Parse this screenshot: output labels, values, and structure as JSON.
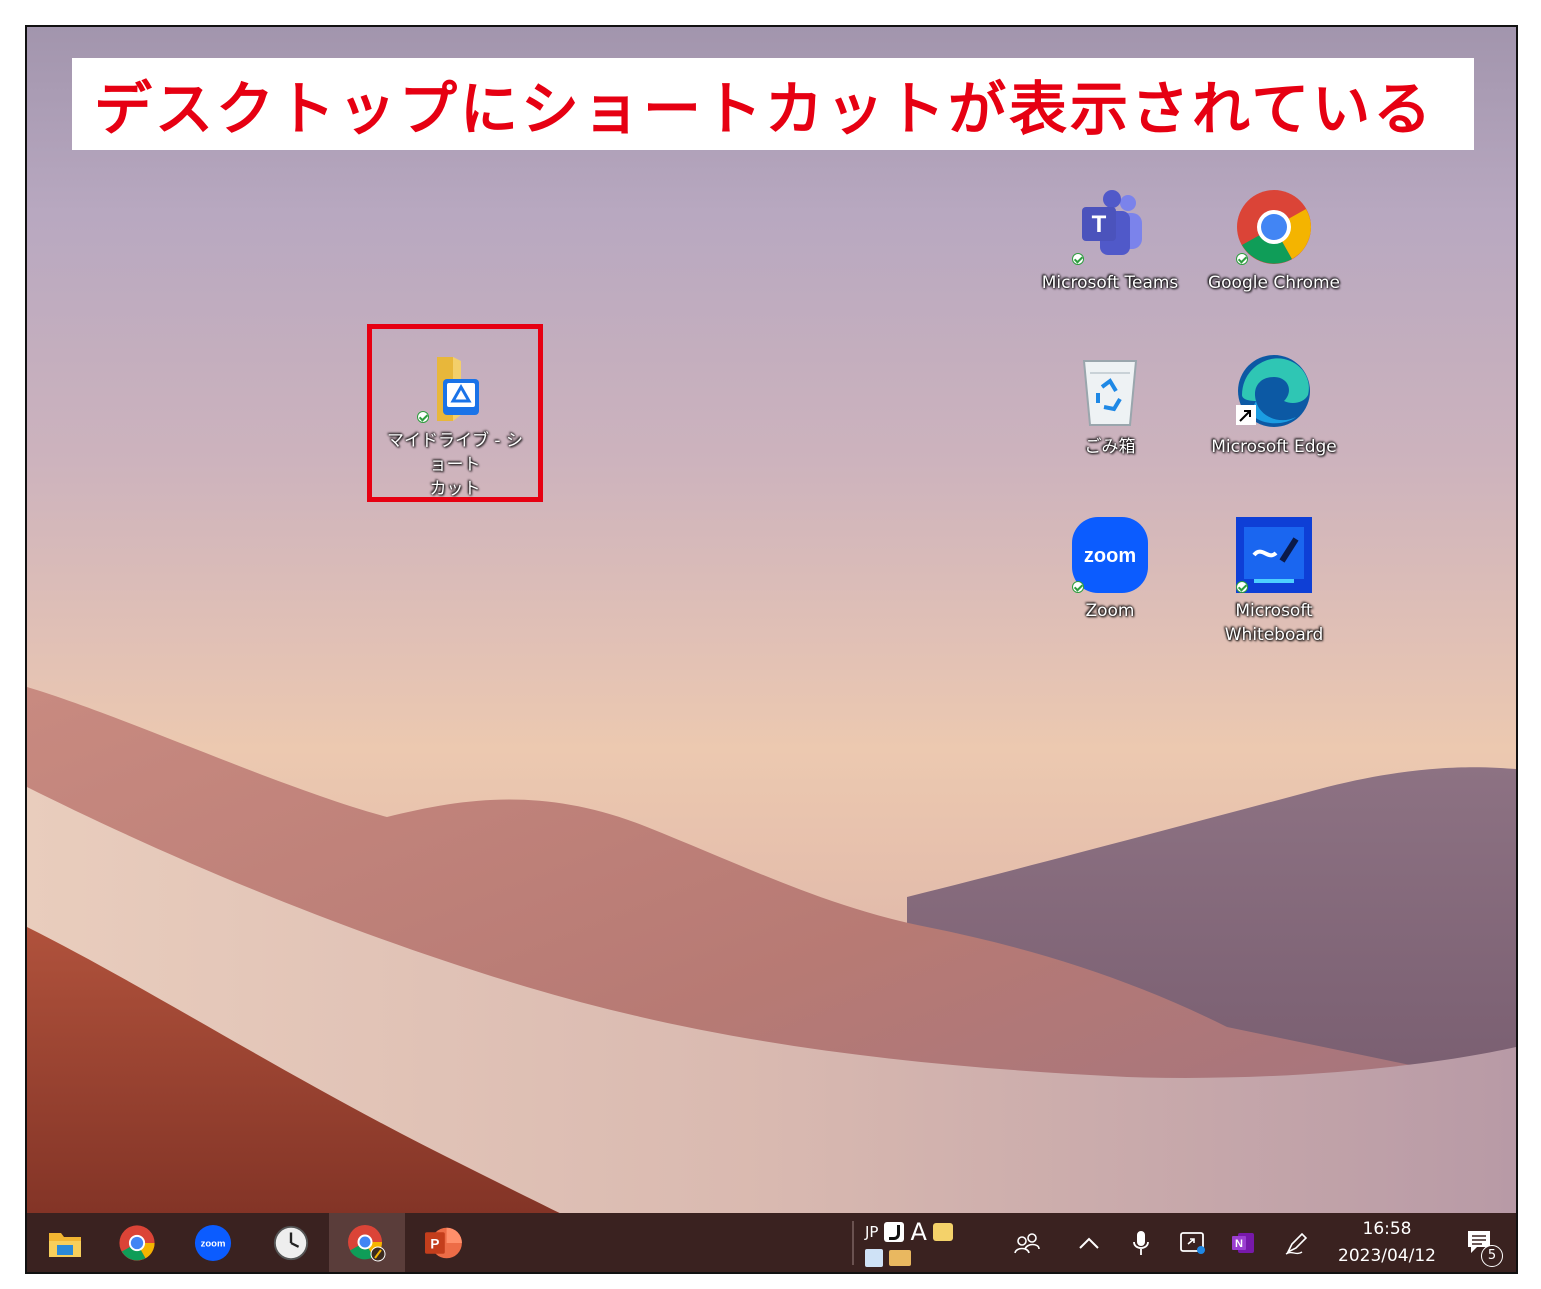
{
  "banner": {
    "text": "デスクトップにショートカットが表示されている"
  },
  "desktop_icons": {
    "drive_shortcut": {
      "label": "マイドライブ - ショート\nカット",
      "icon": "google-drive-folder-icon"
    },
    "teams": {
      "label": "Microsoft Teams",
      "icon": "teams-icon"
    },
    "chrome": {
      "label": "Google Chrome",
      "icon": "chrome-icon"
    },
    "recycle_bin": {
      "label": "ごみ箱",
      "icon": "recycle-bin-icon"
    },
    "edge": {
      "label": "Microsoft Edge",
      "icon": "edge-icon"
    },
    "zoom": {
      "label": "Zoom",
      "icon": "zoom-icon",
      "logo_text": "zoom"
    },
    "whiteboard": {
      "label": "Microsoft\nWhiteboard",
      "icon": "whiteboard-icon"
    }
  },
  "taskbar": {
    "apps": [
      "file-explorer-icon",
      "chrome-icon",
      "zoom-icon",
      "clock-icon",
      "chrome-profile-icon",
      "powerpoint-icon"
    ],
    "zoom_logo_text": "zoom",
    "powerpoint_letter": "P",
    "tray": {
      "lang": "JP",
      "ime_mode": "A",
      "onenote_letter": "N",
      "notification_count": "5"
    },
    "clock": {
      "time": "16:58",
      "date": "2023/04/12"
    }
  },
  "colors": {
    "accent_red": "#e60012",
    "taskbar": "#3a2220"
  }
}
